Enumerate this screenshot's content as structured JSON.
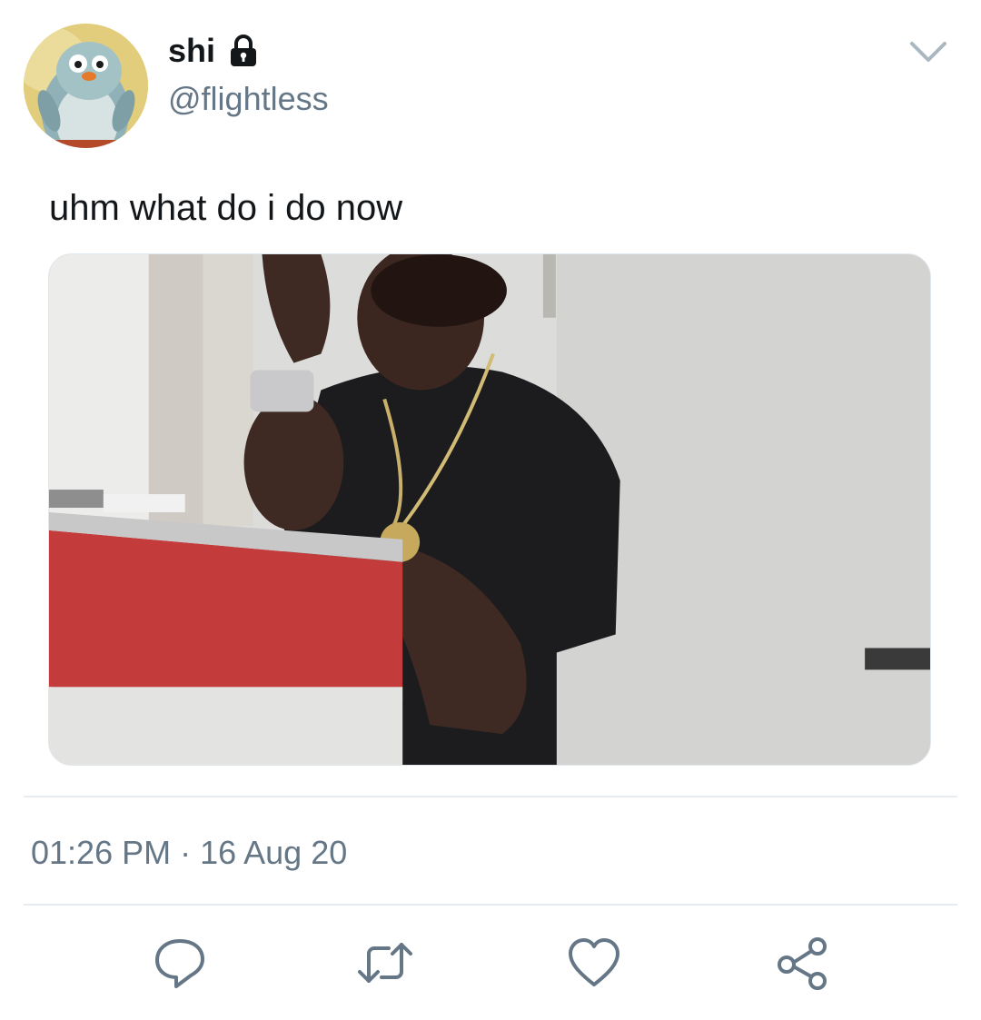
{
  "author": {
    "display_name": "shi",
    "handle": "@flightless",
    "protected_icon": "lock-icon",
    "avatar_icon": "penguin-avatar"
  },
  "tweet": {
    "text": "uhm what do i do now",
    "media_kind": "photo",
    "timestamp": "01:26 PM · 16 Aug 20"
  },
  "menu_icon": "chevron-down-icon",
  "actions": [
    {
      "name": "reply",
      "icon": "reply-icon"
    },
    {
      "name": "retweet",
      "icon": "retweet-icon"
    },
    {
      "name": "like",
      "icon": "heart-icon"
    },
    {
      "name": "share",
      "icon": "share-icon"
    }
  ],
  "colors": {
    "text_primary": "#14171a",
    "text_secondary": "#657786",
    "icon": "#657786",
    "divider": "#e6ecf0"
  }
}
